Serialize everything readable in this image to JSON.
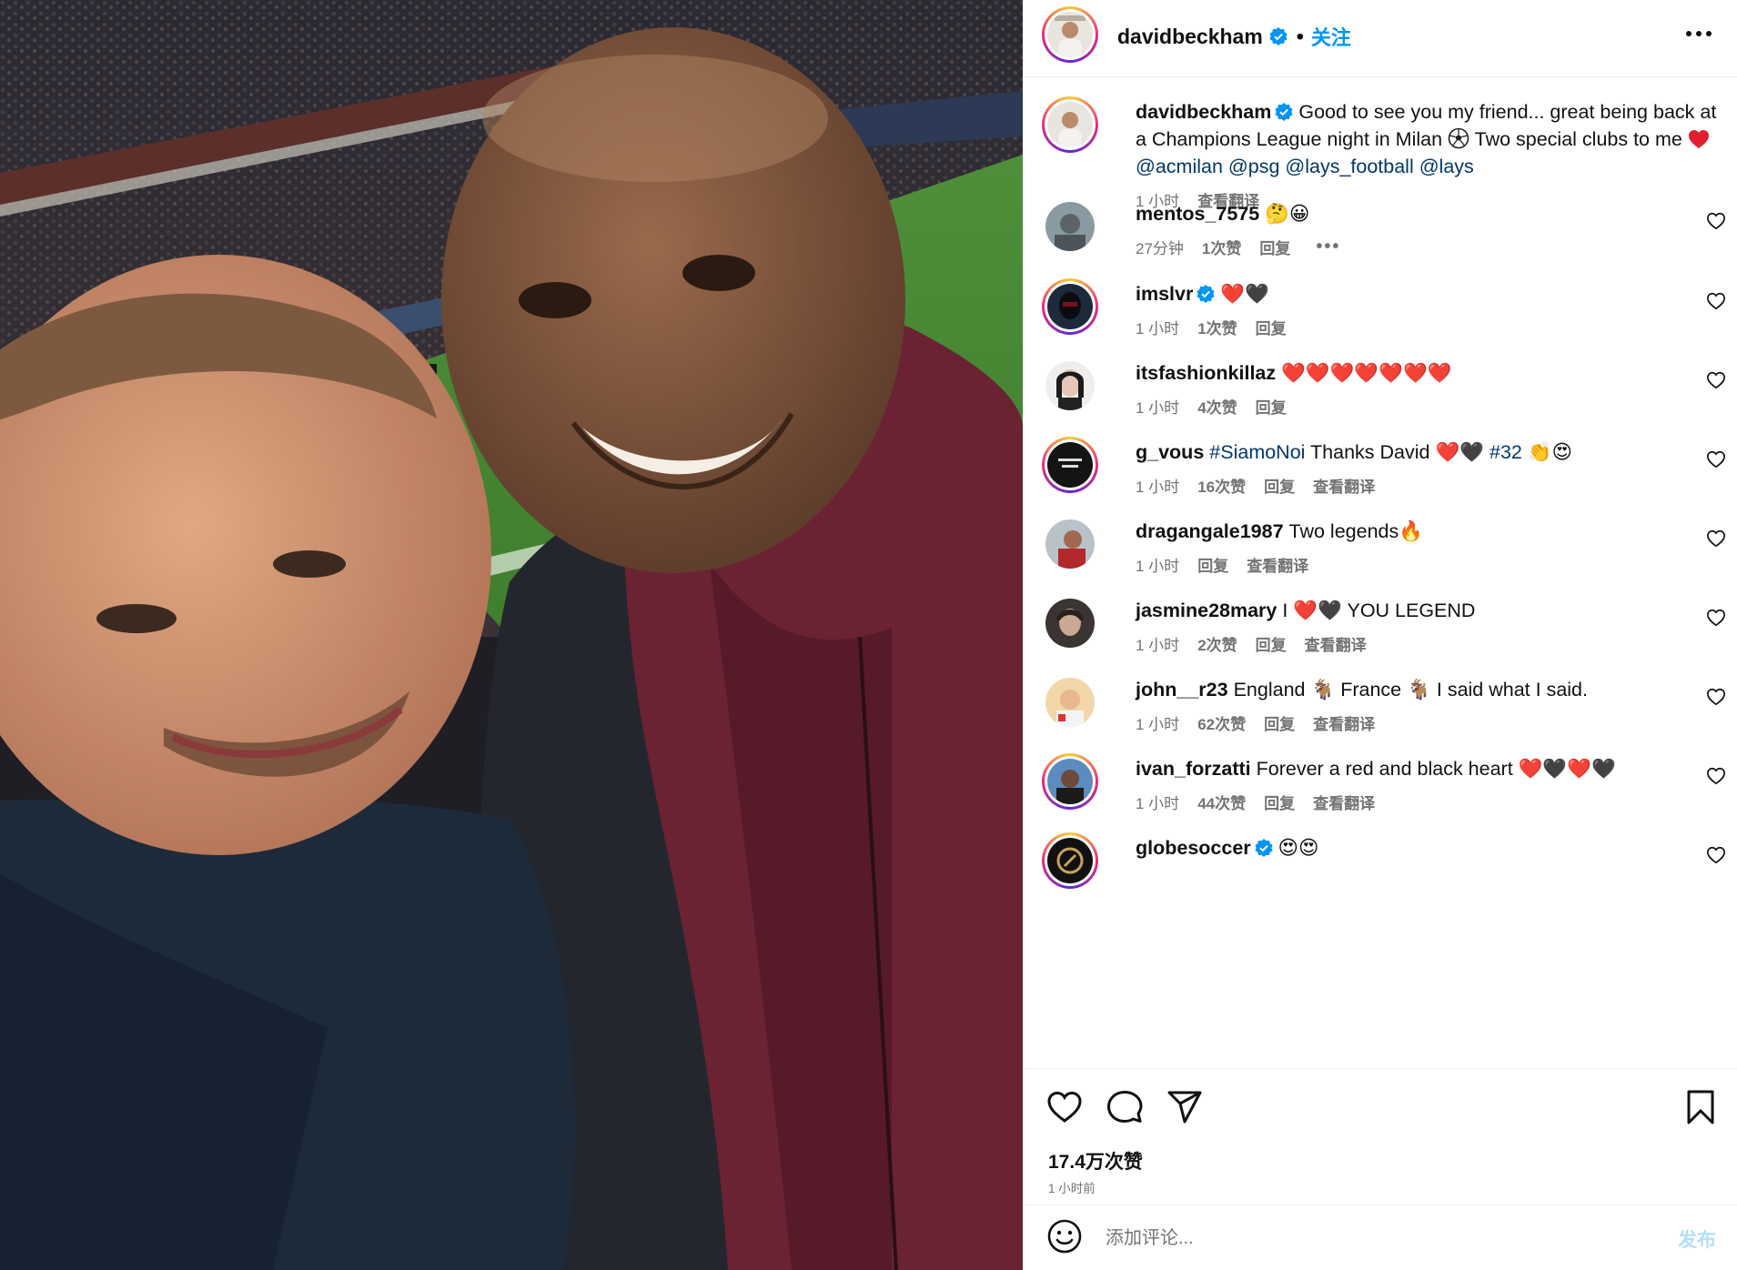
{
  "post": {
    "username": "davidbeckham",
    "verified": true,
    "separator": "•",
    "follow_label": "关注",
    "more_icon": "more-horizontal-icon"
  },
  "caption": {
    "username": "davidbeckham",
    "text_1": "Good to see you my friend... great being back at a Champions League night in Milan ",
    "text_2": " Two special clubs to me ",
    "mentions": [
      "@acmilan",
      "@psg",
      "@lays_football",
      "@lays"
    ],
    "time": "1 小时",
    "translate": "查看翻译"
  },
  "comments": [
    {
      "username": "mentos_7575",
      "text": "",
      "emoji": "🤔😀",
      "time": "27分钟",
      "likes": "1次赞",
      "reply": "回复",
      "more": "•••"
    },
    {
      "username": "imslvr",
      "verified": true,
      "text": "",
      "emoji": "❤️🖤",
      "time": "1 小时",
      "likes": "1次赞",
      "reply": "回复"
    },
    {
      "username": "itsfashionkillaz",
      "text": "",
      "emoji": "❤️❤️❤️❤️❤️❤️❤️",
      "time": "1 小时",
      "likes": "4次赞",
      "reply": "回复"
    },
    {
      "username": "g_vous",
      "hashtag": "#SiamoNoi",
      "text": " Thanks David ",
      "emoji": "❤️🖤",
      "hashtag2": "#32",
      "emoji2": "👏😍",
      "time": "1 小时",
      "likes": "16次赞",
      "reply": "回复",
      "translate": "查看翻译"
    },
    {
      "username": "dragangale1987",
      "text": "Two legends",
      "emoji": "🔥",
      "time": "1 小时",
      "reply": "回复",
      "translate": "查看翻译"
    },
    {
      "username": "jasmine28mary",
      "text": "I ",
      "emoji": "❤️🖤",
      "text2": " YOU LEGEND",
      "time": "1 小时",
      "likes": "2次赞",
      "reply": "回复",
      "translate": "查看翻译"
    },
    {
      "username": "john__r23",
      "text": "England ",
      "emoji": "🐐",
      "text2": " France ",
      "emoji2": "🐐",
      "text3": " I said what I said.",
      "time": "1 小时",
      "likes": "62次赞",
      "reply": "回复",
      "translate": "查看翻译"
    },
    {
      "username": "ivan_forzatti",
      "text": "Forever a red and black heart ",
      "emoji": "❤️🖤❤️🖤",
      "time": "1 小时",
      "likes": "44次赞",
      "reply": "回复",
      "translate": "查看翻译"
    },
    {
      "username": "globesoccer",
      "verified": true,
      "text": "",
      "emoji": "😍😍"
    }
  ],
  "actions": {
    "like_icon": "heart-icon",
    "comment_icon": "comment-bubble-icon",
    "share_icon": "send-paper-plane-icon",
    "save_icon": "bookmark-icon",
    "likes_count": "17.4万次赞",
    "posted_ago": "1 小时前"
  },
  "add_comment": {
    "emoji_icon": "smiley-icon",
    "placeholder": "添加评论...",
    "post_label": "发布"
  },
  "colors": {
    "link_blue": "#0095f6",
    "mention_navy": "#00376b",
    "meta_gray": "#737373",
    "post_disabled": "#b2dffc"
  }
}
